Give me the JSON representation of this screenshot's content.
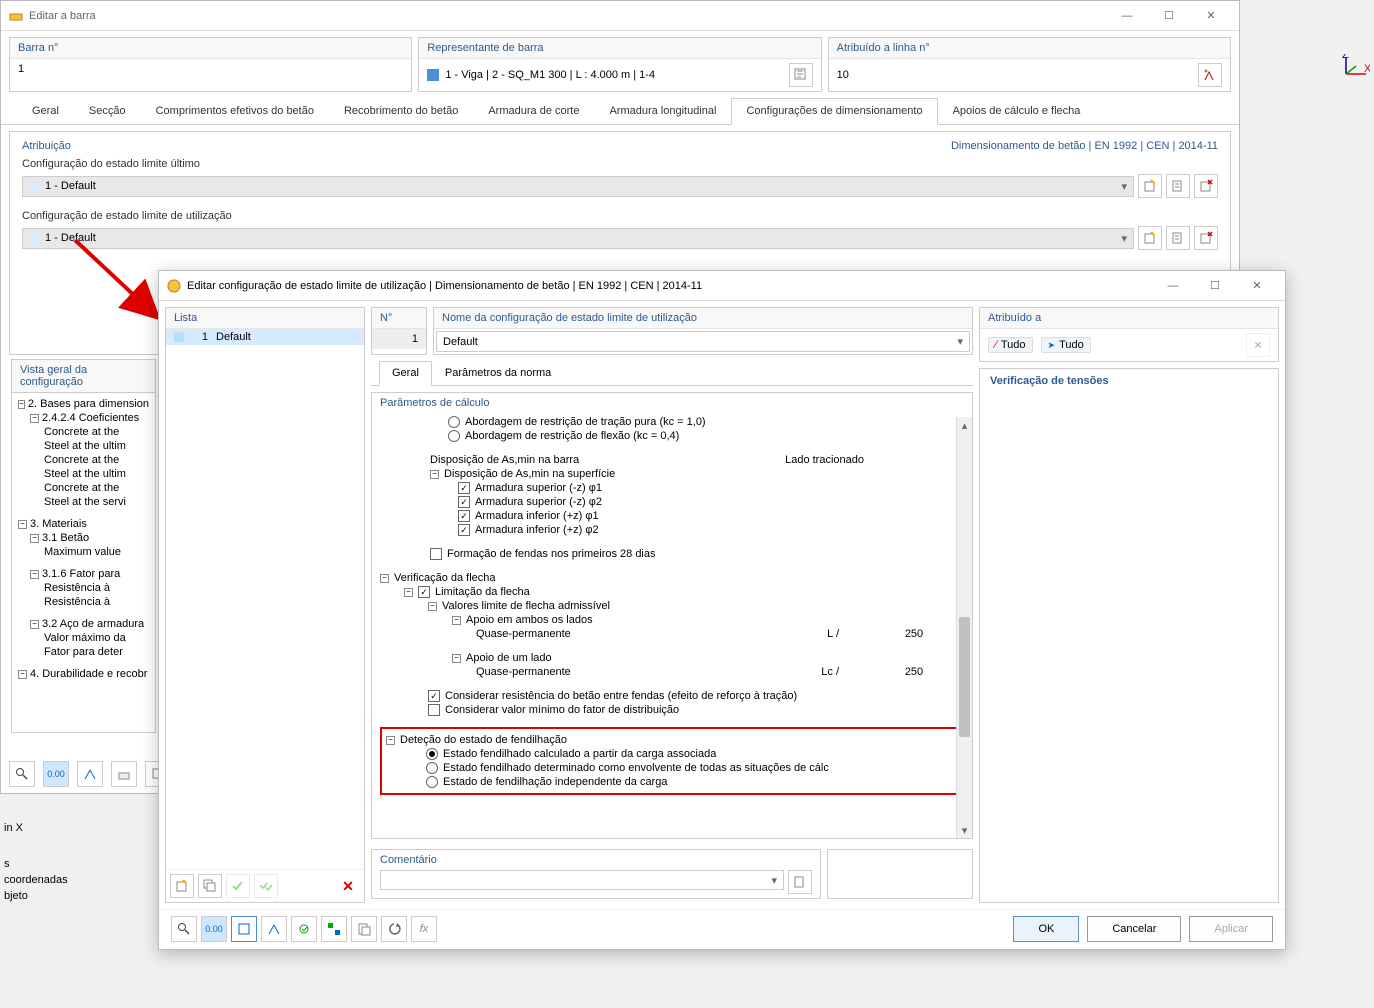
{
  "back": {
    "title": "Editar a barra",
    "barra": {
      "label": "Barra n°",
      "value": "1"
    },
    "representante": {
      "label": "Representante de barra",
      "value": "1 - Viga | 2 - SQ_M1 300 | L : 4.000 m | 1-4"
    },
    "atribuido": {
      "label": "Atribuído a linha n°",
      "value": "10"
    },
    "tabs": [
      "Geral",
      "Secção",
      "Comprimentos efetivos do betão",
      "Recobrimento do betão",
      "Armadura de corte",
      "Armadura longitudinal",
      "Configurações de dimensionamento",
      "Apoios de cálculo e flecha"
    ],
    "active_tab": 6,
    "attrib_title": "Atribuição",
    "norm_title": "Dimensionamento de betão | EN 1992 | CEN | 2014-11",
    "config_ultimo": {
      "label": "Configuração do estado limite último",
      "value": "1 - Default"
    },
    "config_util": {
      "label": "Configuração de estado limite de utilização",
      "value": "1 - Default"
    },
    "overview_title": "Vista geral da configuração",
    "tree": {
      "n2": "2. Bases para dimension",
      "n242": "2.4.2.4 Coeficientes",
      "c1": "Concrete at the",
      "c2": "Steel at the ultim",
      "c3": "Concrete at the",
      "c4": "Steel at the ultim",
      "c5": "Concrete at the",
      "c6": "Steel at the servi",
      "n3": "3. Materiais",
      "n31": "3.1 Betão",
      "c7": "Maximum value",
      "n316": "3.1.6 Fator para",
      "c8": "Resistência à",
      "c9": "Resistência à",
      "n32": "3.2 Aço de armadura",
      "c10": "Valor máximo da",
      "c11": "Fator para deter",
      "n4": "4. Durabilidade e recobr"
    }
  },
  "front": {
    "title": "Editar configuração de estado limite de utilização | Dimensionamento de betão | EN 1992 | CEN | 2014-11",
    "lista": {
      "header": "Lista",
      "num": "1",
      "name": "Default"
    },
    "n_header": "N°",
    "n_value": "1",
    "nome": {
      "header": "Nome da configuração de estado limite de utilização",
      "value": "Default"
    },
    "atrib": {
      "header": "Atribuído a",
      "tudo": "Tudo"
    },
    "inner_tabs": [
      "Geral",
      "Parâmetros da norma"
    ],
    "param_header": "Parâmetros de cálculo",
    "p": {
      "trac": "Abordagem de restrição de tração pura (kc = 1,0)",
      "flex": "Abordagem de restrição de flexão (kc = 0,4)",
      "disp_barra": "Disposição de As,min na barra",
      "disp_barra_val": "Lado tracionado",
      "disp_sup": "Disposição de As,min na superfície",
      "as1": "Armadura superior (-z) φ1",
      "as2": "Armadura superior (-z) φ2",
      "ai1": "Armadura inferior (+z) φ1",
      "ai2": "Armadura inferior (+z) φ2",
      "fendas28": "Formação de fendas nos primeiros 28 dias",
      "ver_flecha": "Verificação da flecha",
      "lim_flecha": "Limitação da flecha",
      "val_lim": "Valores limite de flecha admissível",
      "apoio_ambos": "Apoio em ambos os lados",
      "quase": "Quase-permanente",
      "l_div": "L /",
      "val250": "250",
      "apoio_um": "Apoio de um lado",
      "lc_div": "Lc /",
      "resist": "Considerar resistência do betão entre fendas (efeito de reforço à tração)",
      "fator_dist": "Considerar valor mínimo do fator de distribuição",
      "detecao": "Deteção do estado de fendilhação",
      "est1": "Estado fendilhado calculado a partir da carga associada",
      "est2": "Estado fendilhado determinado como envolvente de todas as situações de cálc",
      "est3": "Estado de fendilhação independente da carga"
    },
    "comentario": "Comentário",
    "right_header": "Verificação de tensões",
    "ok": "OK",
    "cancel": "Cancelar",
    "apply": "Aplicar"
  },
  "bottom": {
    "x": "in X",
    "s": "s",
    "coord": "coordenadas",
    "obj": "bjeto"
  }
}
